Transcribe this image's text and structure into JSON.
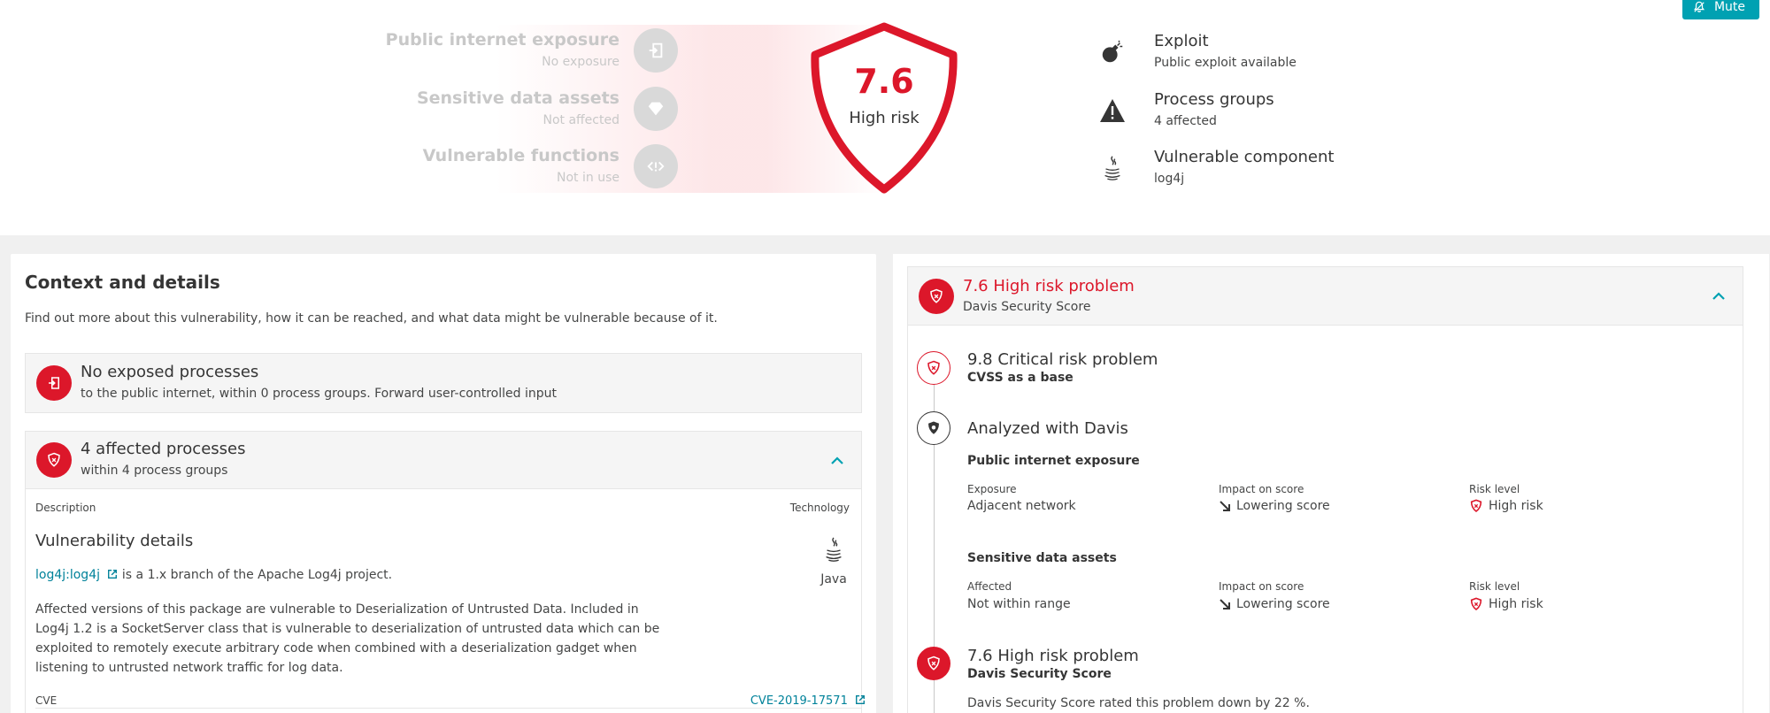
{
  "header": {
    "mute_label": "Mute",
    "factors": [
      {
        "title": "Public internet exposure",
        "subtitle": "No exposure",
        "icon": "exposure-icon"
      },
      {
        "title": "Sensitive data assets",
        "subtitle": "Not affected",
        "icon": "diamond-icon"
      },
      {
        "title": "Vulnerable functions",
        "subtitle": "Not in use",
        "icon": "code-icon"
      }
    ],
    "score": {
      "value": "7.6",
      "label": "High risk",
      "color": "#dc172a"
    },
    "meta": [
      {
        "title": "Exploit",
        "subtitle": "Public exploit available",
        "icon": "bomb-icon"
      },
      {
        "title": "Process groups",
        "subtitle": "4 affected",
        "icon": "warning-icon"
      },
      {
        "title": "Vulnerable component",
        "subtitle": "log4j",
        "icon": "java-icon"
      }
    ]
  },
  "context": {
    "title": "Context and details",
    "description": "Find out more about this vulnerability, how it can be reached, and what data might be vulnerable because of it.",
    "exposed": {
      "title": "No exposed processes",
      "subtitle": "to the public internet, within 0 process groups. Forward user-controlled input"
    },
    "affected": {
      "title": "4 affected processes",
      "subtitle": "within 4 process groups"
    },
    "table": {
      "col_description": "Description",
      "col_technology": "Technology"
    },
    "details": {
      "title": "Vulnerability details",
      "library_link": "log4j:log4j",
      "library_text": " is a 1.x branch of the Apache Log4j project.",
      "body": "Affected versions of this package are vulnerable to Deserialization of Untrusted Data. Included in Log4j 1.2 is a SocketServer class that is vulnerable to deserialization of untrusted data which can be exploited to remotely execute arbitrary code when combined with a deserialization gadget when listening to untrusted network traffic for log data.",
      "technology": "Java",
      "cve_label": "CVE",
      "cve_value": "CVE-2019-17571"
    }
  },
  "davis": {
    "header_title": "7.6 High risk problem",
    "header_subtitle": "Davis Security Score",
    "steps": {
      "base_title": "9.8 Critical risk problem",
      "base_subtitle": "CVSS as a base",
      "analyzed_title": "Analyzed with Davis",
      "final_title": "7.6 High risk problem",
      "final_subtitle": "Davis Security Score",
      "final_note": "Davis Security Score rated this problem down by 22 %."
    },
    "sections": [
      {
        "title": "Public internet exposure",
        "col1_label": "Exposure",
        "col1_value": "Adjacent network",
        "col2_label": "Impact on score",
        "col2_value": "Lowering score",
        "col3_label": "Risk level",
        "col3_value": "High risk"
      },
      {
        "title": "Sensitive data assets",
        "col1_label": "Affected",
        "col1_value": "Not within range",
        "col2_label": "Impact on score",
        "col2_value": "Lowering score",
        "col3_label": "Risk level",
        "col3_value": "High risk"
      }
    ]
  }
}
